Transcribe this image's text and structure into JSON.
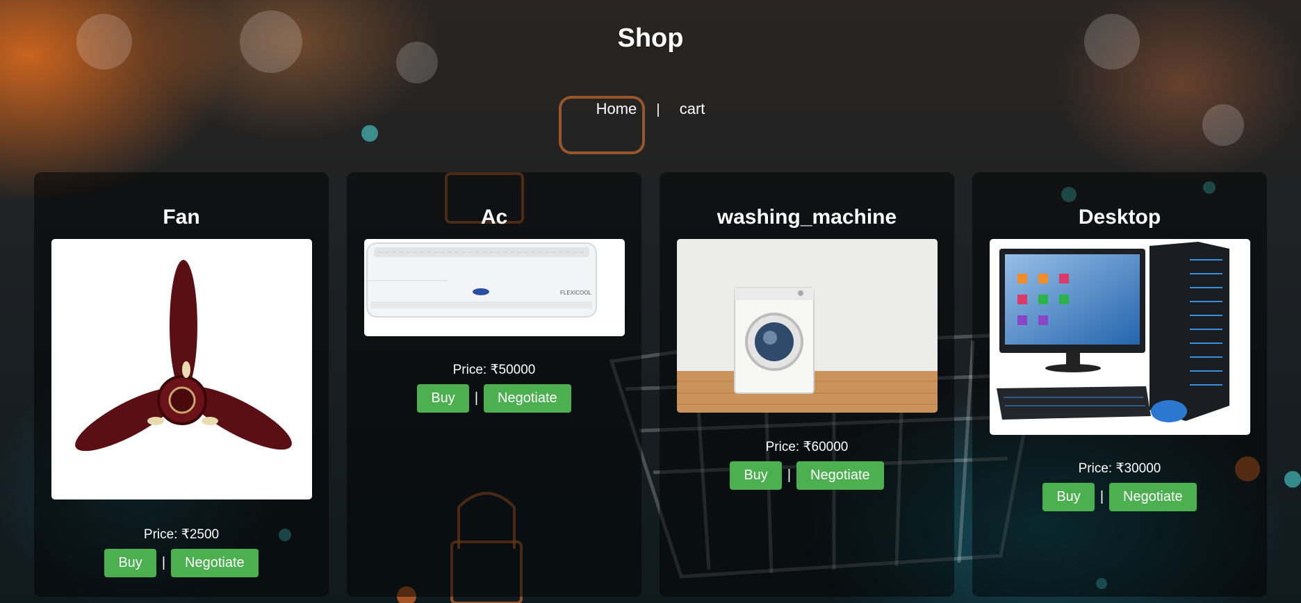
{
  "header": {
    "title": "Shop"
  },
  "nav": {
    "home": "Home",
    "separator": "|",
    "cart": "cart"
  },
  "products": [
    {
      "name": "Fan",
      "price": "Price: ₹2500",
      "buy": "Buy",
      "separator": "|",
      "negotiate": "Negotiate"
    },
    {
      "name": "Ac",
      "price": "Price: ₹50000",
      "buy": "Buy",
      "separator": "|",
      "negotiate": "Negotiate"
    },
    {
      "name": "washing_machine",
      "price": "Price: ₹60000",
      "buy": "Buy",
      "separator": "|",
      "negotiate": "Negotiate"
    },
    {
      "name": "Desktop",
      "price": "Price: ₹30000",
      "buy": "Buy",
      "separator": "|",
      "negotiate": "Negotiate"
    }
  ],
  "colors": {
    "button": "#4caf50",
    "card_bg": "rgba(0,0,0,0.5)",
    "accent_bg": "#e07020"
  }
}
